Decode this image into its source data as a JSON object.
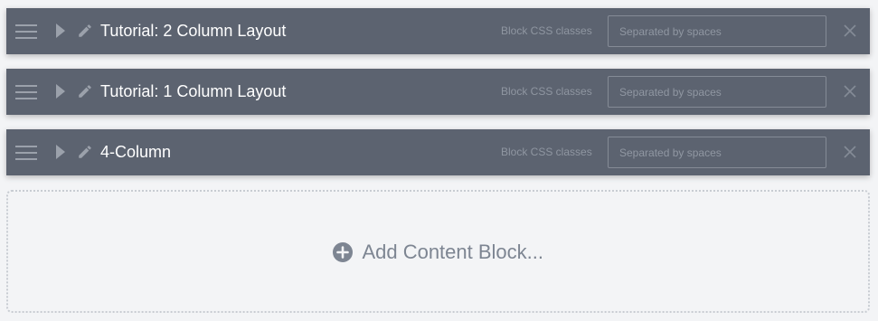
{
  "blocks": [
    {
      "title": "Tutorial: 2 Column Layout",
      "css_label": "Block CSS classes",
      "css_placeholder": "Separated by spaces",
      "css_value": ""
    },
    {
      "title": "Tutorial: 1 Column Layout",
      "css_label": "Block CSS classes",
      "css_placeholder": "Separated by spaces",
      "css_value": ""
    },
    {
      "title": "4-Column",
      "css_label": "Block CSS classes",
      "css_placeholder": "Separated by spaces",
      "css_value": ""
    }
  ],
  "add_block": {
    "label": "Add Content Block..."
  },
  "icons": {
    "drag": "hamburger-drag-icon",
    "expand": "triangle-right-icon",
    "edit": "pencil-icon",
    "remove": "close-x-icon",
    "add": "plus-circle-icon"
  },
  "colors": {
    "row_background": "#5c6370",
    "page_background": "#f3f4f6",
    "muted_icon": "#9ba1ab",
    "add_label": "#7d8592"
  }
}
